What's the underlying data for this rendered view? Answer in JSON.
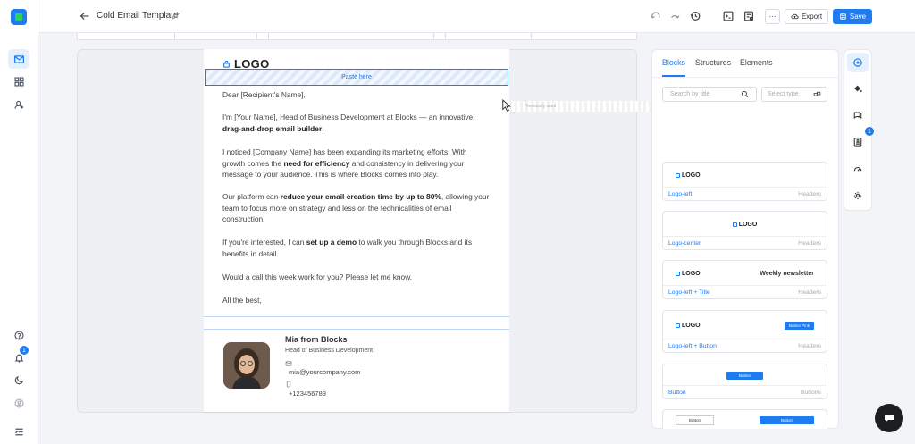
{
  "app": {
    "title": "Cold Email Template"
  },
  "toolbar": {
    "export_label": "Export",
    "save_label": "Save",
    "more_label": "···"
  },
  "rail": {
    "notification_count": "1"
  },
  "email": {
    "logo_text": "LOGO",
    "paste_label": "Paste here",
    "greeting": "Dear [Recipient's Name],",
    "p1_a": "I'm [Your Name], Head of Business Development at Blocks — an innovative,",
    "p1_b": "drag-and-drop email builder",
    "p1_c": ".",
    "p2_a": "I noticed [Company Name] has been expanding its marketing efforts. With growth comes the ",
    "p2_b": "need for efficiency",
    "p2_c": " and consistency in delivering your message to your audience. This is where Blocks comes into play.",
    "p3_a": "Our platform can ",
    "p3_b": "reduce your email creation time by up to 80%",
    "p3_c": ", allowing your team to focus more on strategy and less on the technicalities of email construction.",
    "p4_a": "If you're interested, I can ",
    "p4_b": "set up a demo",
    "p4_c": " to walk you through Blocks and its benefits in detail.",
    "p5": "Would a call this week work for you? Please let me know.",
    "closing": "All the best,",
    "signature": {
      "name": "Mia from Blocks",
      "role": "Head of Business Development",
      "email": "mia@yourcompany.com",
      "phone": "+123456789"
    },
    "drag_ghost": "Previously used"
  },
  "panel": {
    "tabs": [
      {
        "label": "Blocks"
      },
      {
        "label": "Structures"
      },
      {
        "label": "Elements"
      }
    ],
    "search_placeholder": "Search by title",
    "type_placeholder": "Select type",
    "badge": "1",
    "cards": [
      {
        "label": "Logo-left",
        "category": "Headers",
        "logo": "LOGO"
      },
      {
        "label": "Logo-center",
        "category": "Headers",
        "logo": "LOGO"
      },
      {
        "label": "Logo-left + Title",
        "category": "Headers",
        "logo": "LOGO",
        "title": "Weekly newsletter"
      },
      {
        "label": "Logo-left + Button",
        "category": "Headers",
        "logo": "LOGO",
        "button": "Button Pink"
      },
      {
        "label": "Button",
        "category": "Buttons",
        "button": "Button"
      },
      {
        "button_a": "Button",
        "button_b": "Button"
      }
    ]
  },
  "colors": {
    "accent": "#1e7bf0",
    "canvas": "#eef0f3"
  }
}
